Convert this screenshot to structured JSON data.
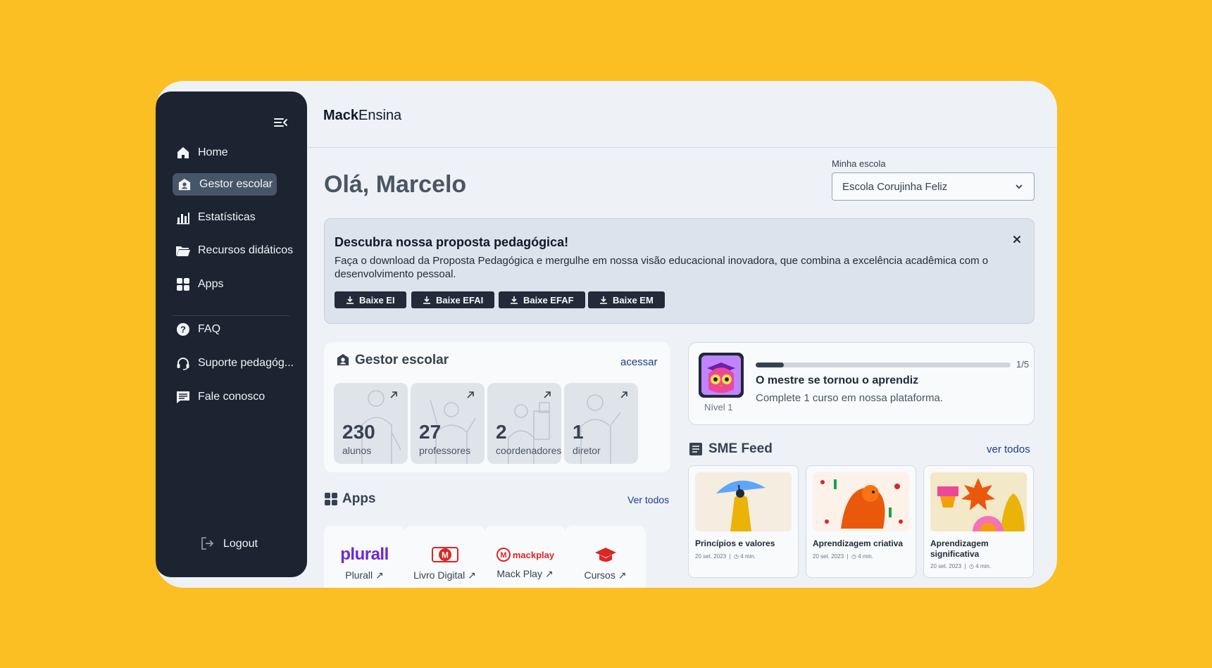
{
  "brand": {
    "bold": "Mack",
    "regular": "Ensina"
  },
  "sidebar": {
    "items": [
      {
        "label": "Home",
        "icon": "home-icon"
      },
      {
        "label": "Gestor escolar",
        "icon": "gestor-icon",
        "active": true
      },
      {
        "label": "Estatísticas",
        "icon": "chart-icon"
      },
      {
        "label": "Recursos didáticos",
        "icon": "folder-icon"
      },
      {
        "label": "Apps",
        "icon": "apps-icon"
      }
    ],
    "secondary": [
      {
        "label": "FAQ",
        "icon": "question-icon"
      },
      {
        "label": "Suporte pedagóg...",
        "icon": "headset-icon"
      },
      {
        "label": "Fale conosco",
        "icon": "chat-icon"
      }
    ],
    "logout": "Logout"
  },
  "greeting": "Olá, Marcelo",
  "school": {
    "label": "Minha escola",
    "value": "Escola Corujinha Feliz"
  },
  "banner": {
    "title": "Descubra nossa proposta pedagógica!",
    "text": "Faça o download da Proposta Pedagógica e mergulhe em nossa visão educacional inovadora, que combina a excelência acadêmica com o desenvolvimento pessoal.",
    "buttons": [
      "Baixe EI",
      "Baixe EFAI",
      "Baixe EFAF",
      "Baixe EM"
    ]
  },
  "gestor": {
    "title": "Gestor escolar",
    "link": "acessar",
    "stats": [
      {
        "value": "230",
        "label": "alunos"
      },
      {
        "value": "27",
        "label": "professores"
      },
      {
        "value": "2",
        "label": "coordenadores"
      },
      {
        "value": "1",
        "label": "diretor"
      }
    ]
  },
  "apps": {
    "title": "Apps",
    "link": "Ver todos",
    "items": [
      {
        "name": "Plurall",
        "logo_text": "plurall",
        "color": "#6d28d9"
      },
      {
        "name": "Livro Digital",
        "color": "#dc2626"
      },
      {
        "name": "Mack Play",
        "logo_text": "mackplay",
        "color": "#dc2626"
      },
      {
        "name": "Cursos",
        "color": "#dc2626"
      }
    ]
  },
  "progress": {
    "count": "1/5",
    "fraction": 0.11,
    "title": "O mestre se tornou o aprendiz",
    "subtitle": "Complete 1 curso em nossa plataforma.",
    "level": "Nível 1"
  },
  "feed": {
    "title": "SME Feed",
    "link": "ver todos",
    "items": [
      {
        "title": "Princípios e valores",
        "date": "20 set. 2023",
        "read": "4 min."
      },
      {
        "title": "Aprendizagem criativa",
        "date": "20 set. 2023",
        "read": "4 min."
      },
      {
        "title": "Aprendizagem significativa",
        "date": "20 set. 2023",
        "read": "4 min."
      }
    ]
  },
  "colors": {
    "background": "#FBBF24",
    "sidebar": "#1c2331",
    "accent": "#1d3a8a"
  }
}
